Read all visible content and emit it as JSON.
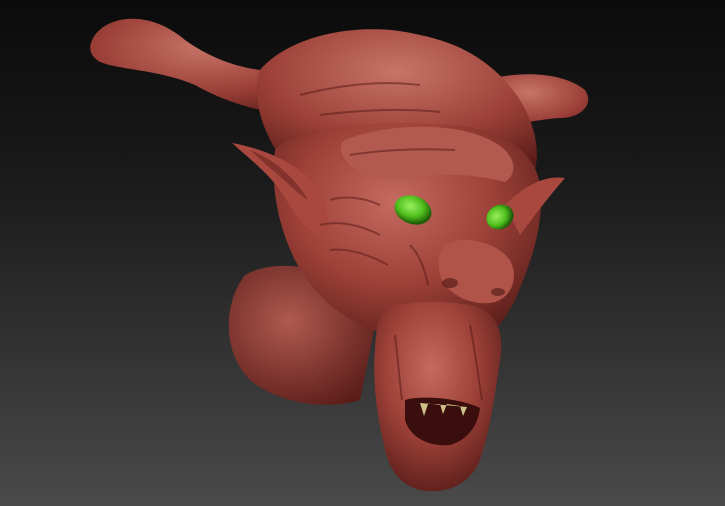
{
  "scene": {
    "subject": "goblin-head-sculpt",
    "colors": {
      "background_top": "#0b0b0b",
      "background_bottom": "#4a4a4a",
      "skin": "#9c4038",
      "skin_highlight": "#c56a5f",
      "skin_shadow": "#4d1714",
      "eyes": "#4fbf1c",
      "teeth": "#cfbf8a"
    }
  }
}
